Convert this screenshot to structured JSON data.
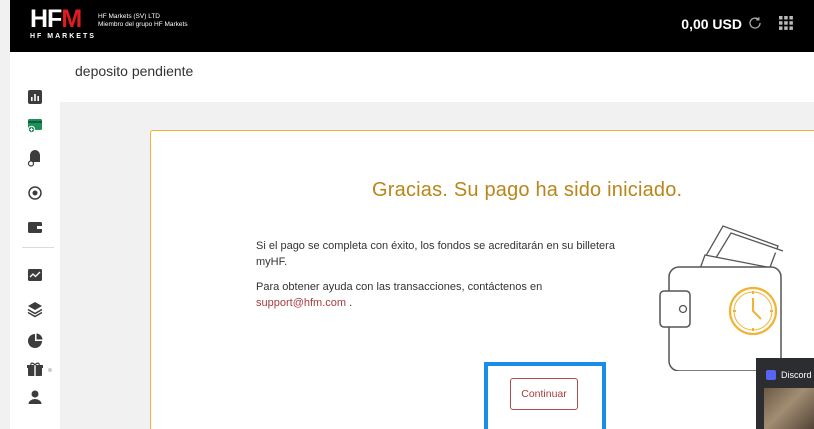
{
  "topbar": {
    "logo_text": "HFM",
    "logo_subtext": "HF MARKETS",
    "company_line1": "HF Markets (SV) LTD",
    "company_line2": "Miembro del grupo HF Markets",
    "balance": "0,00 USD"
  },
  "sidebar": {
    "icons": [
      "chart-icon",
      "deposit-wallet-icon",
      "withdraw-icon",
      "transfer-icon",
      "wallet-icon",
      "analytics-icon",
      "layers-icon",
      "pie-chart-icon",
      "gift-icon",
      "user-icon"
    ]
  },
  "page": {
    "title": "deposito pendiente"
  },
  "card": {
    "heading": "Gracias. Su pago ha sido iniciado.",
    "message1": "Si el pago se completa con éxito, los fondos se acreditarán en su billetera myHF.",
    "message2_prefix": "Para obtener ayuda con las transacciones, contáctenos en",
    "email": "support@hfm.com",
    "message2_suffix": " .",
    "button_label": "Continuar"
  },
  "overlay": {
    "discord_label": "Discord"
  },
  "colors": {
    "accent_gold": "#b8861b",
    "card_border": "#f2b233",
    "button_red": "#a93b3b",
    "highlight_blue": "#1a8de8",
    "active_sidebar": "#1e8e5a"
  }
}
